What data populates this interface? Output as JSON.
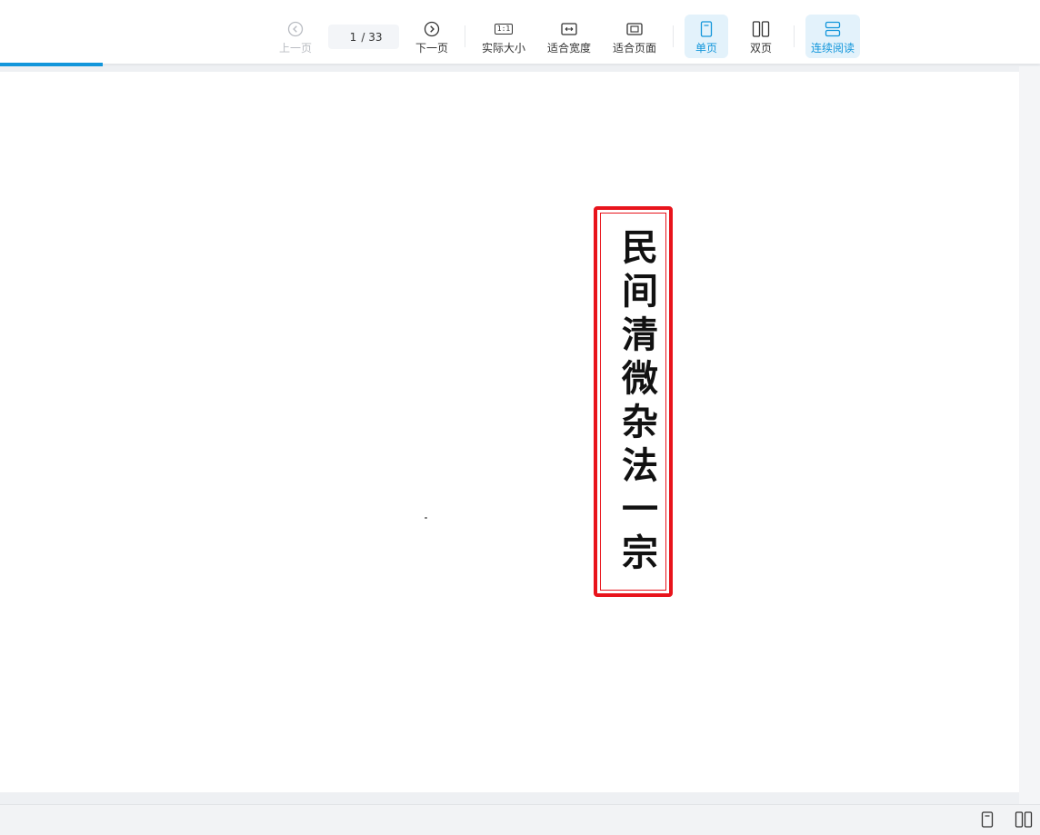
{
  "toolbar": {
    "prev_label": "上一页",
    "current_page": "1",
    "total_pages": "/ 33",
    "next_label": "下一页",
    "actual_size_label": "实际大小",
    "fit_width_label": "适合宽度",
    "fit_page_label": "适合页面",
    "single_page_label": "单页",
    "double_page_label": "双页",
    "continuous_label": "连续阅读",
    "actual_size_icon_text": "1:1"
  },
  "progress": {
    "fraction": 0.0989
  },
  "document": {
    "cover_title": "民间清微杂法一宗"
  },
  "colors": {
    "accent": "#1296db",
    "label_border": "#e8141c"
  },
  "icons": {
    "prev": "chevron-left-circle-icon",
    "next": "chevron-right-circle-icon",
    "actual_size": "one-to-one-icon",
    "fit_width": "fit-width-icon",
    "fit_page": "fit-page-icon",
    "single_page": "single-page-icon",
    "double_page": "double-page-icon",
    "continuous": "continuous-scroll-icon"
  }
}
